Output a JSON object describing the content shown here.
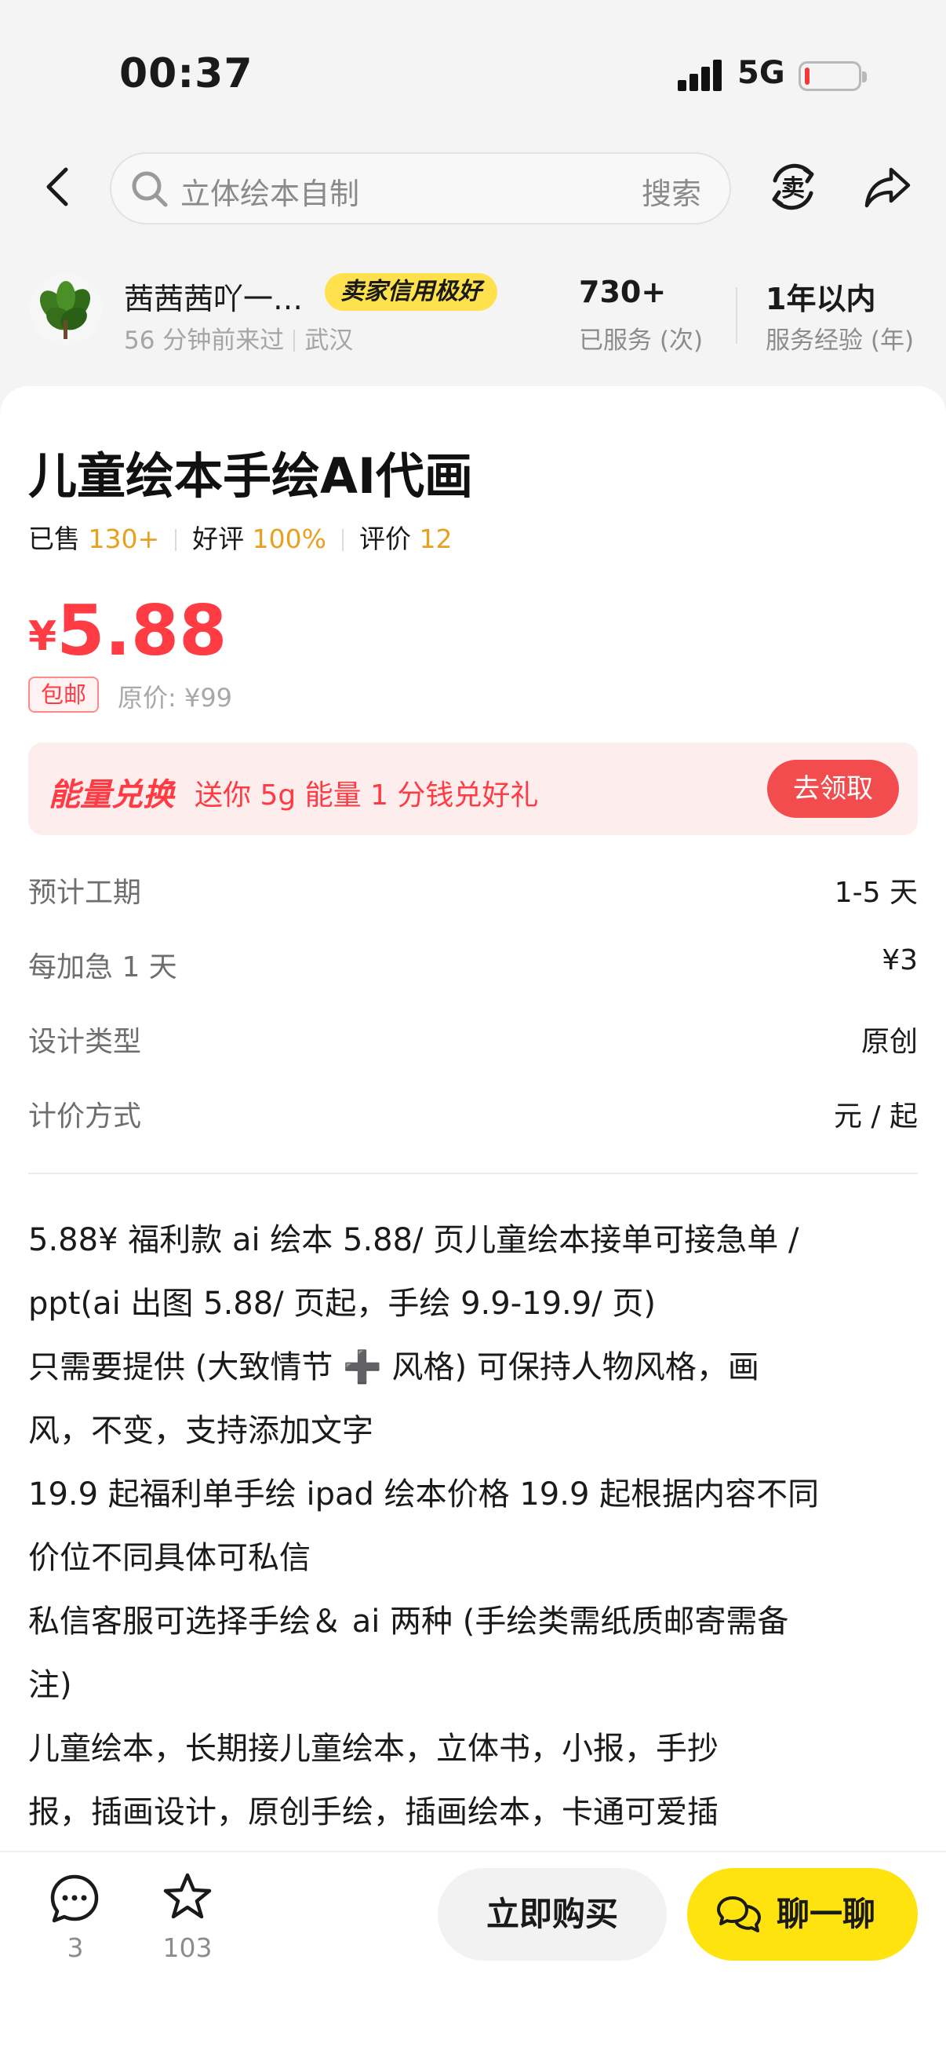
{
  "status_bar": {
    "time": "00:37",
    "network": "5G",
    "battery_level": 0.08
  },
  "header": {
    "search_placeholder": "立体绘本自制",
    "search_button": "搜索",
    "sell_icon_label": "卖"
  },
  "seller": {
    "name": "茜茜茜吖一…",
    "badge": "卖家信用极好",
    "last_seen": "56 分钟前来过",
    "location": "武汉",
    "stats": [
      {
        "value": "730+",
        "label": "已服务 (次)"
      },
      {
        "value": "1年以内",
        "label": "服务经验 (年)"
      }
    ]
  },
  "product": {
    "title": "儿童绘本手绘AI代画",
    "sold_label": "已售",
    "sold_value": "130+",
    "good_label": "好评",
    "good_value": "100%",
    "review_label": "评价",
    "review_value": "12",
    "currency": "¥",
    "price": "5.88",
    "free_shipping": "包邮",
    "original_price": "原价: ¥99"
  },
  "promo": {
    "brand": "能量兑换",
    "text": "送你 5g 能量 1 分钱兑好礼",
    "button": "去领取"
  },
  "specs": [
    {
      "label": "预计工期",
      "value": "1-5 天"
    },
    {
      "label": "每加急 1 天",
      "value": "¥3"
    },
    {
      "label": "设计类型",
      "value": "原创"
    },
    {
      "label": "计价方式",
      "value": "元 / 起"
    }
  ],
  "description": [
    "5.88¥ 福利款 ai 绘本 5.88/ 页儿童绘本接单可接急单 /",
    "ppt(ai 出图 5.88/ 页起，手绘 9.9-19.9/ 页)",
    "只需要提供 (大致情节 ➕ 风格) 可保持人物风格，画",
    "风，不变，支持添加文字",
    "19.9 起福利单手绘 ipad 绘本价格 19.9 起根据内容不同",
    "价位不同具体可私信",
    "私信客服可选择手绘＆ ai 两种 (手绘类需纸质邮寄需备",
    "注)",
    " 儿童绘本，长期接儿童绘本，立体书，小报，手抄",
    "报，插画设计，原创手绘，插画绘本，卡通可爱插"
  ],
  "bottom_bar": {
    "comments": "3",
    "favorites": "103",
    "buy": "立即购买",
    "chat": "聊一聊"
  }
}
